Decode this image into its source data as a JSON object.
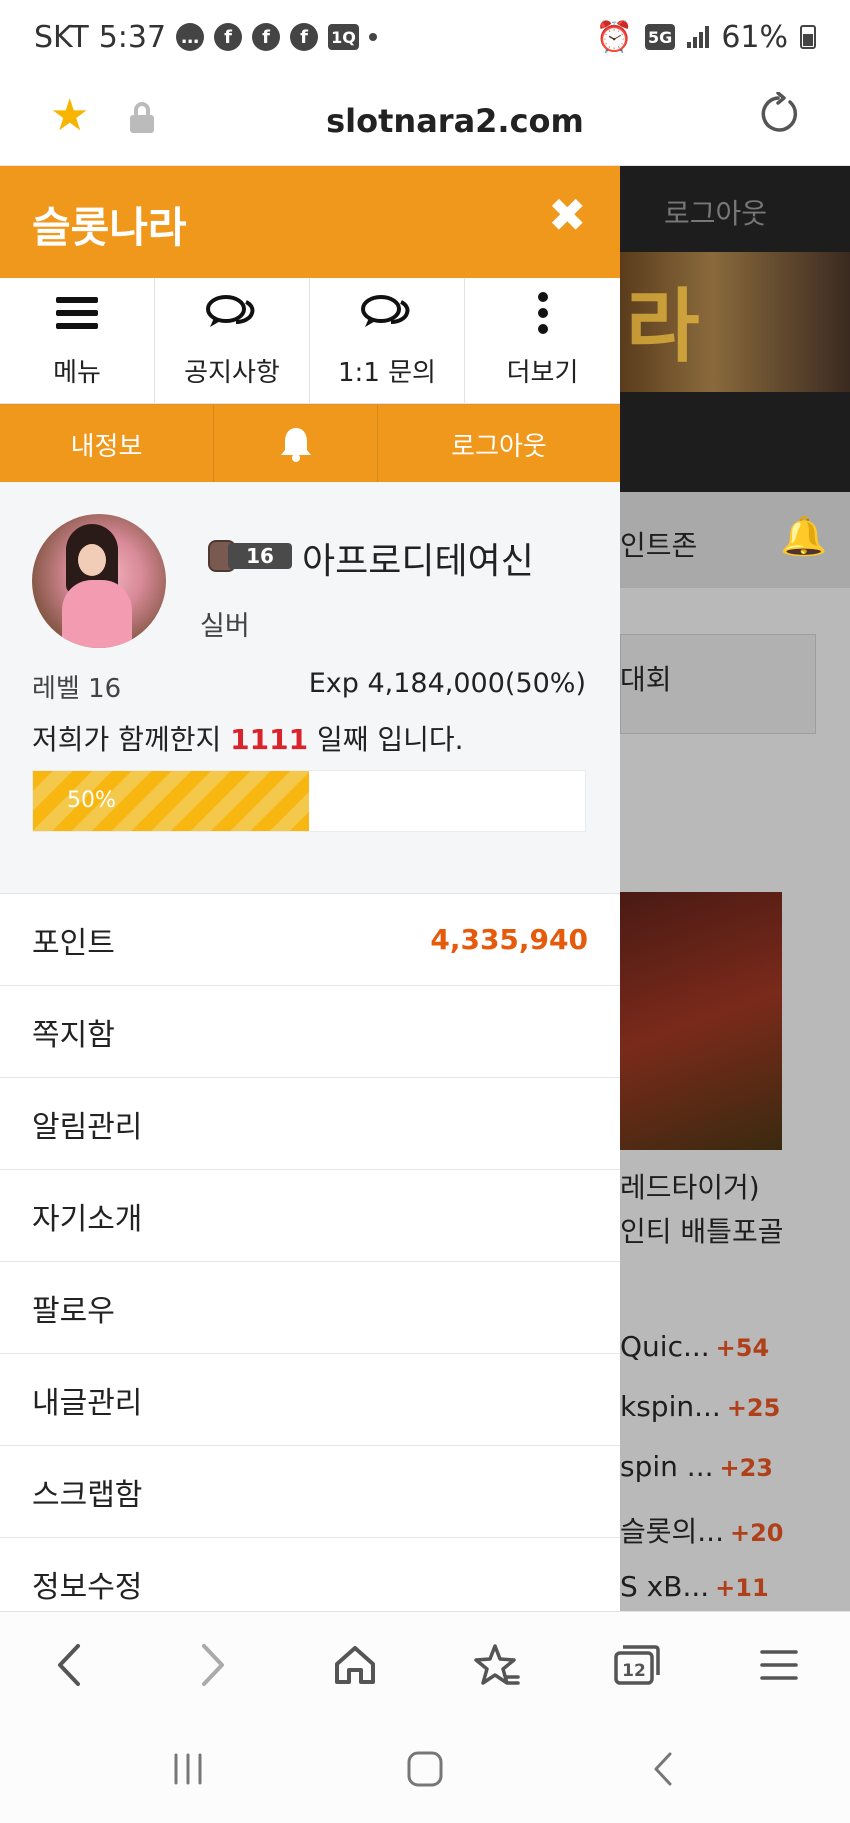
{
  "status_bar": {
    "carrier": "SKT",
    "time": "5:37",
    "network": "5G",
    "battery": "61%",
    "app_icons": [
      "chat-bubble-icon",
      "facebook-icon",
      "facebook-icon",
      "facebook-icon",
      "1q-icon"
    ]
  },
  "browser": {
    "url": "slotnara2.com",
    "tabs_count": "12"
  },
  "drawer": {
    "title": "슬롯나라",
    "quick_menu": [
      {
        "label": "메뉴",
        "icon": "hamburger-icon"
      },
      {
        "label": "공지사항",
        "icon": "chat-icon"
      },
      {
        "label": "1:1 문의",
        "icon": "chat-icon"
      },
      {
        "label": "더보기",
        "icon": "more-vertical-icon"
      }
    ],
    "user_bar": {
      "my_info": "내정보",
      "logout": "로그아웃"
    },
    "profile": {
      "level_badge": "16",
      "nickname": "아프로디테여신",
      "grade": "실버",
      "level_text": "레벨 16",
      "exp_text": "Exp 4,184,000(50%)",
      "together_prefix": "저희가 함께한지 ",
      "together_days": "1111",
      "together_suffix": " 일째 입니다.",
      "progress_label": "50%",
      "progress_percent": 50
    },
    "menu_items": [
      {
        "label": "포인트",
        "value": "4,335,940"
      },
      {
        "label": "쪽지함"
      },
      {
        "label": "알림관리"
      },
      {
        "label": "자기소개"
      },
      {
        "label": "팔로우"
      },
      {
        "label": "내글관리"
      },
      {
        "label": "스크랩함"
      },
      {
        "label": "정보수정"
      }
    ]
  },
  "background_page": {
    "logout": "로그아웃",
    "banner_char": "라",
    "nav_text": "인트존",
    "box_text": "대회",
    "post_title_1": "레드타이거)",
    "post_title_2": "인티 배틀포골",
    "rank_items": [
      {
        "text": "Quic...",
        "delta": "+54"
      },
      {
        "text": "kspin...",
        "delta": "+25"
      },
      {
        "text": "spin ...",
        "delta": "+23"
      },
      {
        "text": "슬롯의...",
        "delta": "+20"
      },
      {
        "text": "S xB...",
        "delta": "+11"
      }
    ]
  },
  "colors": {
    "brand_orange": "#f0981c",
    "progress_yellow": "#f8b610",
    "point_value": "#e65a0c",
    "days_highlight": "#d9242c"
  }
}
